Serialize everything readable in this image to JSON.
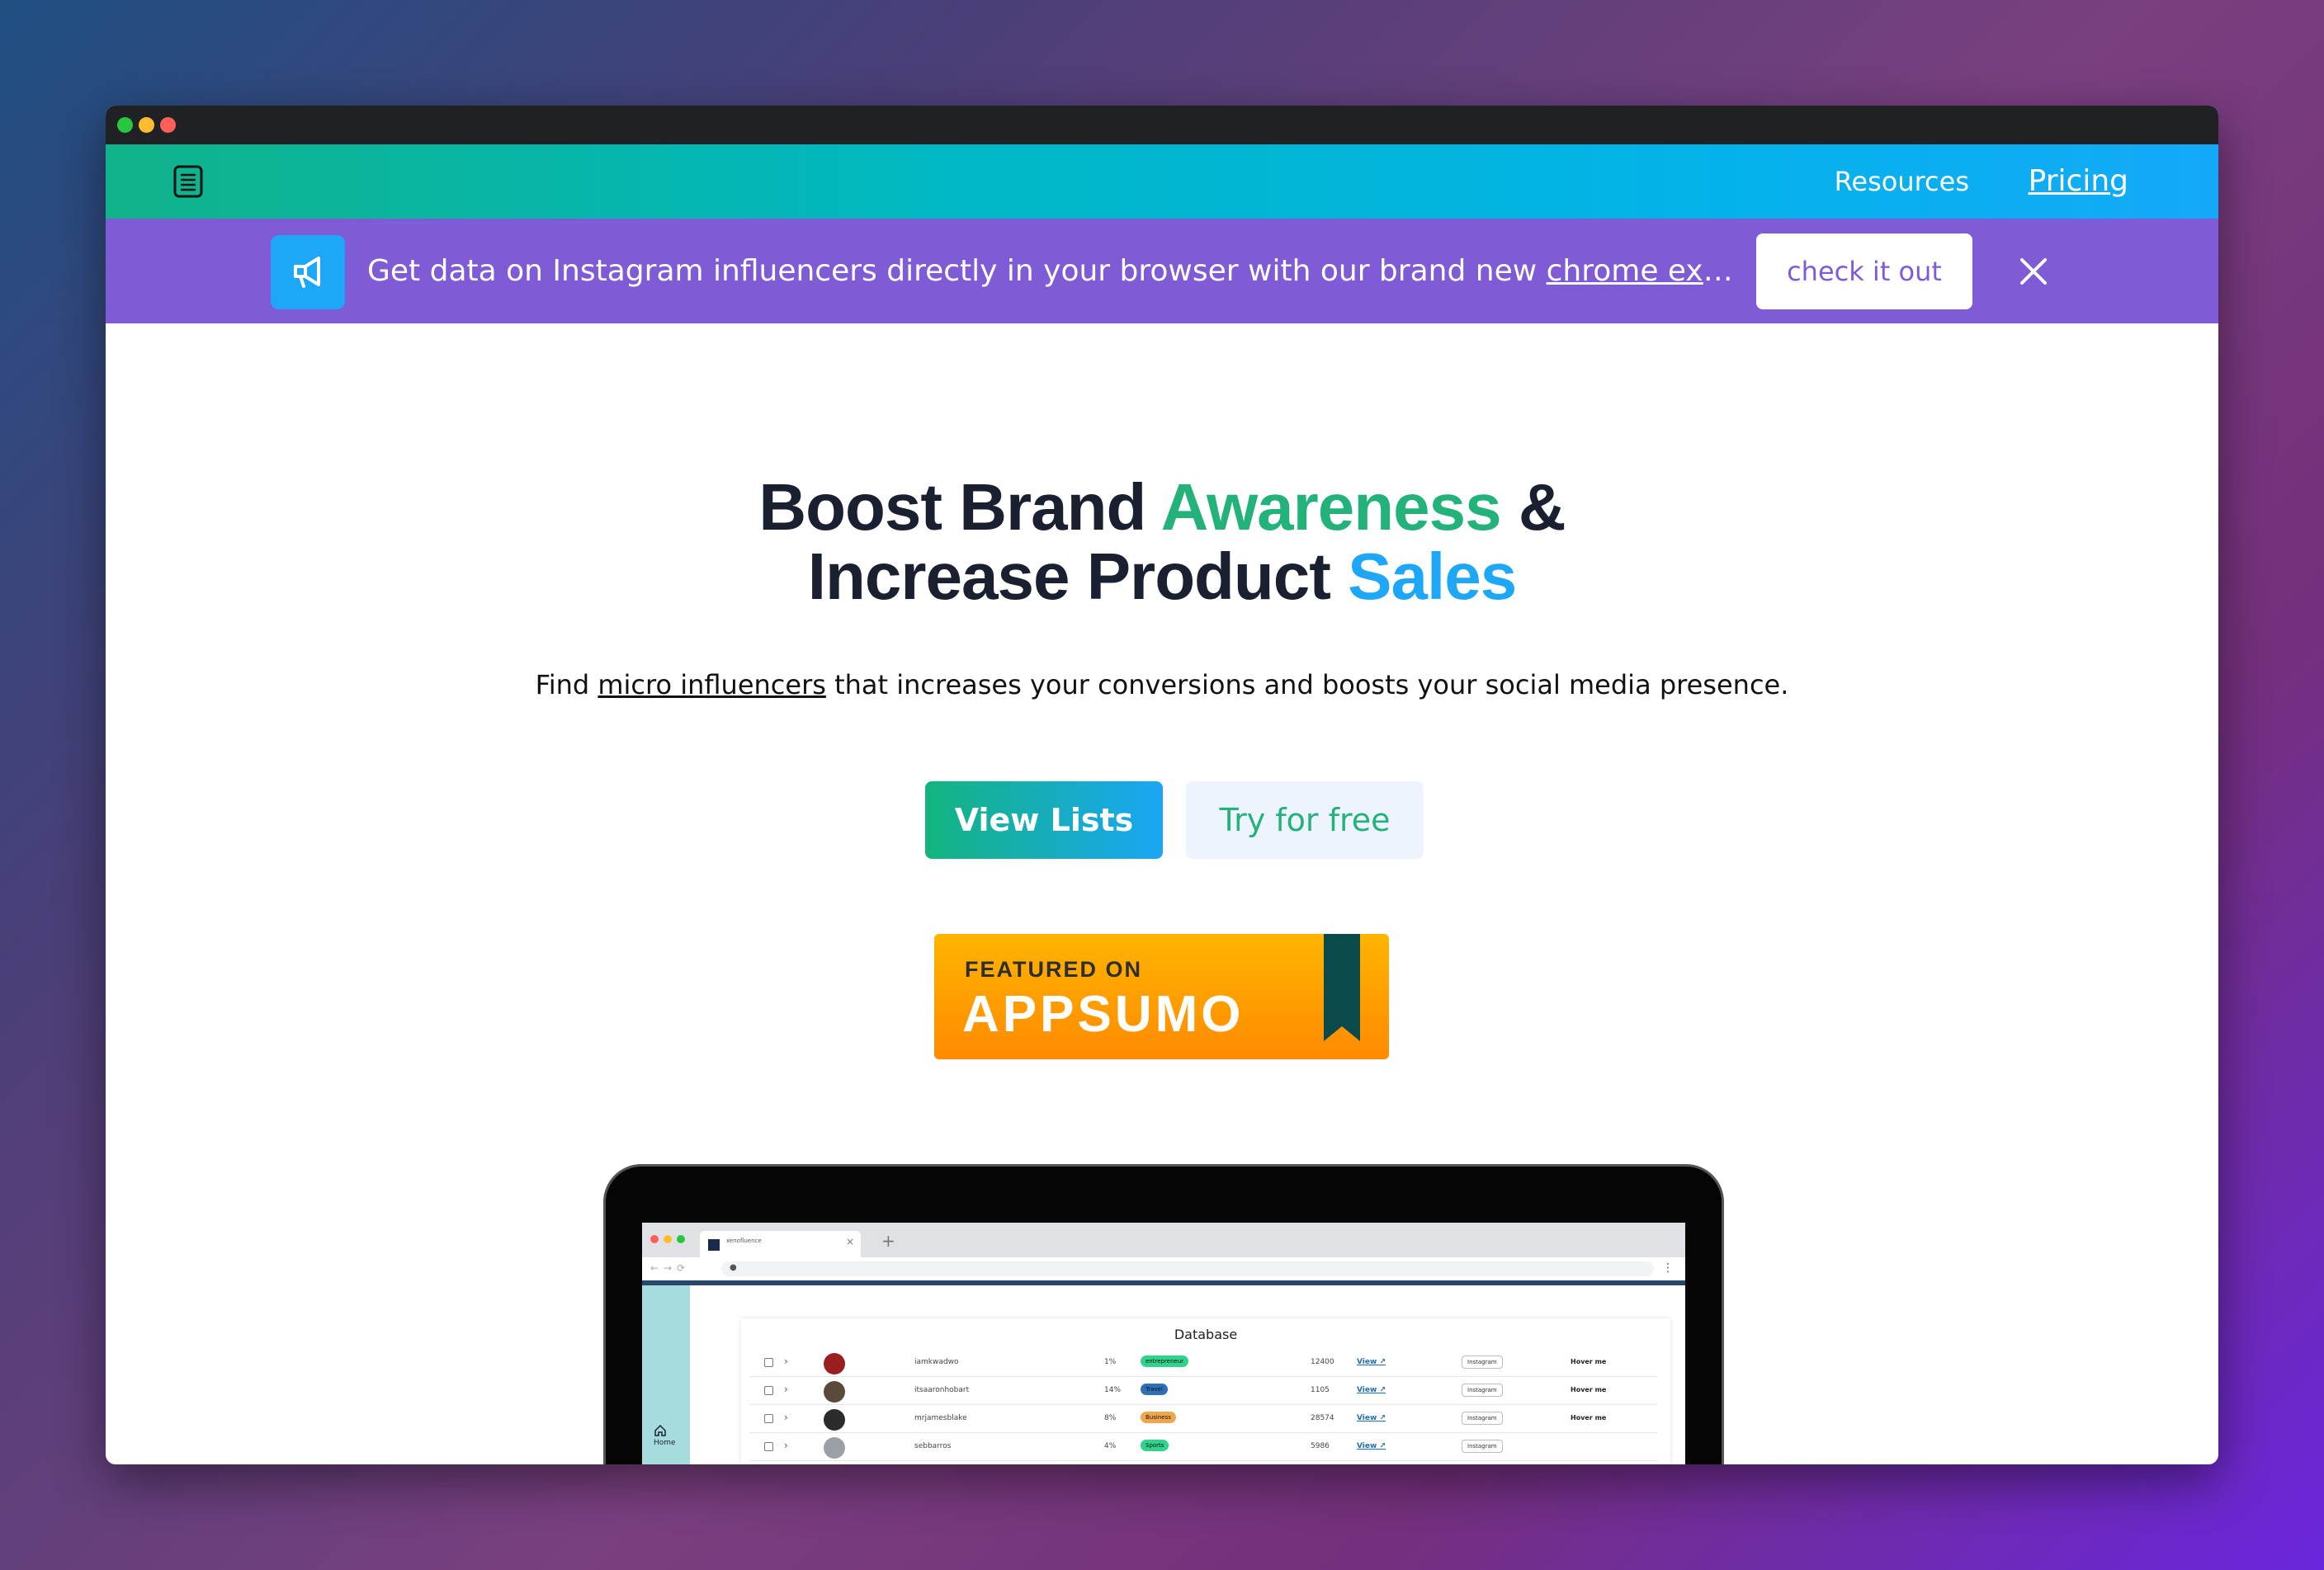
{
  "window": {
    "nav": {
      "logo_icon": "notebook-icon",
      "links": [
        {
          "label": "Resources"
        },
        {
          "label": "Pricing"
        }
      ]
    },
    "banner": {
      "icon": "megaphone-icon",
      "text_before": "Get data on Instagram influencers directly in your browser with our brand new ",
      "link_text": "chrome extension",
      "button_label": "check it out",
      "close_icon": "close-icon"
    },
    "hero": {
      "title_line1_start": "Boost Brand ",
      "title_line1_highlight": "Awareness",
      "title_line1_end": " &",
      "title_line2_start": "Increase Product ",
      "title_line2_highlight": "Sales",
      "subtitle_before": "Find ",
      "subtitle_link": "micro influencers",
      "subtitle_after": " that increases your conversions and boosts your social media presence.",
      "primary_button": "View Lists",
      "secondary_button": "Try for free"
    },
    "badge": {
      "top_text": "FEATURED ON",
      "main_text": "APPSUMO"
    },
    "preview": {
      "tab_title": "xenofluence",
      "table_title": "Database",
      "sidebar_home": "Home",
      "rows": [
        {
          "username": "iamkwadwo",
          "rate": "1%",
          "tag": "entrepreneur",
          "tag_color": "#2fd38a",
          "followers": "12400",
          "view": "View",
          "platform": "Instagram",
          "action": "Hover me",
          "avatar_color": "#9b1e1e"
        },
        {
          "username": "itsaaronhobart",
          "rate": "14%",
          "tag": "Travel",
          "tag_color": "#2f6fb8",
          "followers": "1105",
          "view": "View",
          "platform": "Instagram",
          "action": "Hover me",
          "avatar_color": "#5a4a3a"
        },
        {
          "username": "mrjamesblake",
          "rate": "8%",
          "tag": "Business",
          "tag_color": "#f0a64a",
          "followers": "28574",
          "view": "View",
          "platform": "Instagram",
          "action": "Hover me",
          "avatar_color": "#2b2b2b"
        },
        {
          "username": "sebbarros",
          "rate": "4%",
          "tag": "Sports",
          "tag_color": "#2fd38a",
          "followers": "5986",
          "view": "View",
          "platform": "Instagram",
          "action": "",
          "avatar_color": "#9aa0a6"
        }
      ]
    }
  }
}
